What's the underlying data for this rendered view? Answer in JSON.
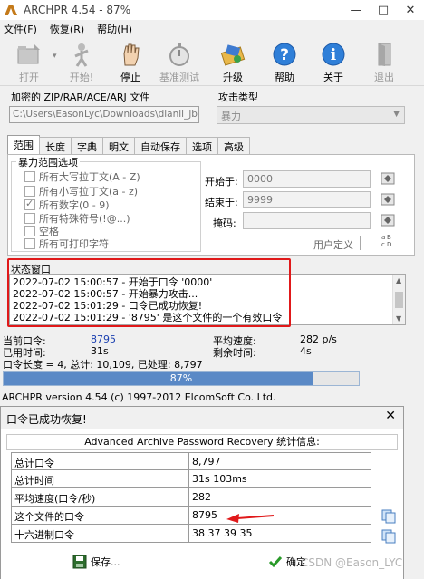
{
  "window": {
    "title": "ARCHPR 4.54 - 87%"
  },
  "menu": [
    "文件(F)",
    "恢复(R)",
    "帮助(H)"
  ],
  "toolbar": [
    {
      "label": "打开",
      "icon": "open-folder-icon",
      "enabled": false
    },
    {
      "label": "开始!",
      "icon": "start-figure-icon",
      "enabled": false
    },
    {
      "label": "停止",
      "icon": "stop-hand-icon",
      "enabled": true
    },
    {
      "label": "基准测试",
      "icon": "benchmark-stopwatch-icon",
      "enabled": false
    },
    {
      "label": "升级",
      "icon": "upgrade-icon",
      "enabled": true
    },
    {
      "label": "帮助",
      "icon": "help-icon",
      "enabled": true
    },
    {
      "label": "关于",
      "icon": "info-icon",
      "enabled": true
    },
    {
      "label": "退出",
      "icon": "exit-door-icon",
      "enabled": false
    }
  ],
  "file": {
    "label": "加密的 ZIP/RAR/ACE/ARJ 文件",
    "path": "C:\\Users\\EasonLyc\\Downloads\\dianli_jbctf"
  },
  "attack": {
    "label": "攻击类型",
    "value": "暴力"
  },
  "tabs": [
    "范围",
    "长度",
    "字典",
    "明文",
    "自动保存",
    "选项",
    "高级"
  ],
  "range": {
    "group_title": "暴力范围选项",
    "charsets": [
      {
        "label": "所有大写拉丁文(A - Z)",
        "checked": false
      },
      {
        "label": "所有小写拉丁文(a - z)",
        "checked": false
      },
      {
        "label": "所有数字(0 - 9)",
        "checked": true
      },
      {
        "label": "所有特殊符号(!@...)",
        "checked": false
      },
      {
        "label": "空格",
        "checked": false
      },
      {
        "label": "所有可打印字符",
        "checked": false
      }
    ],
    "start_label": "开始于:",
    "start_value": "0000",
    "end_label": "结束于:",
    "end_value": "9999",
    "mask_label": "掩码:",
    "mask_value": "",
    "user_defined_label": "用户定义"
  },
  "status": {
    "title": "状态窗口",
    "log": [
      "2022-07-02 15:00:57 - 开始于口令 '0000'",
      "2022-07-02 15:00:57 - 开始暴力攻击...",
      "2022-07-02 15:01:29 - 口令已成功恢复!",
      "2022-07-02 15:01:29 - '8795' 是这个文件的一个有效口令"
    ]
  },
  "stats": {
    "current_label": "当前口令:",
    "current_value": "8795",
    "avg_speed_label": "平均速度:",
    "avg_speed_value": "282 p/s",
    "elapsed_label": "已用时间:",
    "elapsed_value": "31s",
    "remaining_label": "剩余时间:",
    "remaining_value": "4s",
    "summary": "口令长度 = 4, 总计: 10,109, 已处理: 8,797"
  },
  "progress": {
    "percent": 87,
    "text": "87%"
  },
  "copyright": "ARCHPR version 4.54 (c) 1997-2012 ElcomSoft Co. Ltd.",
  "dialog": {
    "title": "口令已成功恢复!",
    "heading": "Advanced Archive Password Recovery 统计信息:",
    "rows": [
      {
        "key": "总计口令",
        "value": "8,797",
        "copy": false
      },
      {
        "key": "总计时间",
        "value": "31s 103ms",
        "copy": false
      },
      {
        "key": "平均速度(口令/秒)",
        "value": "282",
        "copy": false
      },
      {
        "key": "这个文件的口令",
        "value": "8795",
        "copy": true
      },
      {
        "key": "十六进制口令",
        "value": "38 37 39 35",
        "copy": true
      }
    ],
    "save_label": "保存...",
    "ok_label": "确定"
  },
  "watermark": "CSDN @Eason_LYC",
  "colors": {
    "accent": "#5a89c6",
    "highlight": "#e0191a",
    "value_text": "#1a3fb0"
  }
}
